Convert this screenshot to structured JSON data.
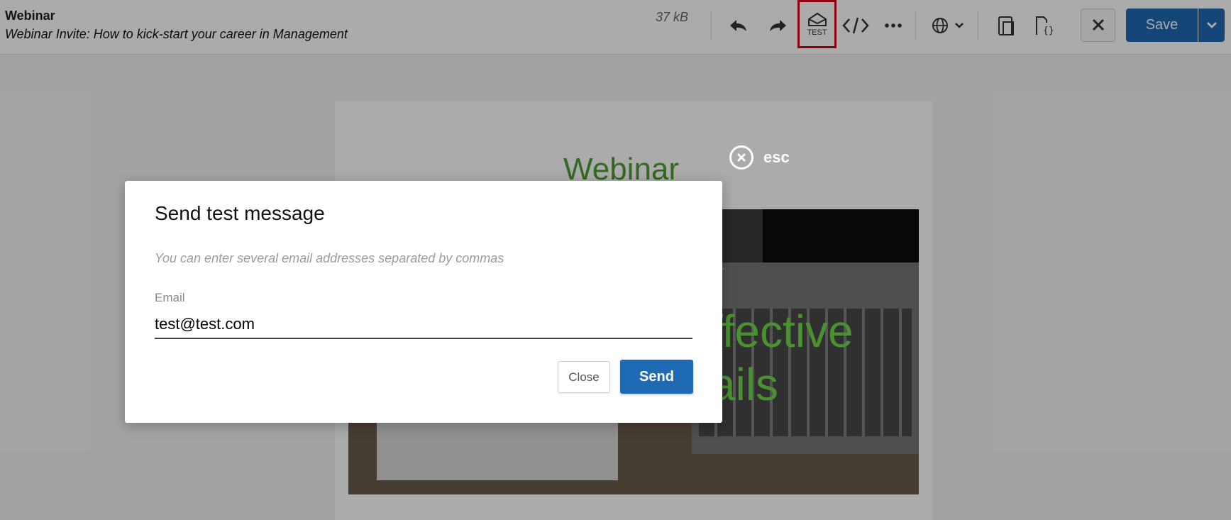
{
  "header": {
    "doc_title": "Webinar",
    "doc_subject": "Webinar Invite: How to kick-start your career in Management",
    "file_size": "37 kB"
  },
  "toolbar": {
    "undo_icon": "undo-icon",
    "redo_icon": "redo-icon",
    "test_label": "TEST",
    "code_icon": "code-icon",
    "more_icon": "more-icon",
    "language_icon": "globe-icon",
    "preview_icon": "device-preview-icon",
    "template_code_icon": "template-code-icon",
    "close_icon": "close-icon",
    "save_label": "Save"
  },
  "preview": {
    "logo_text": "Webinar",
    "hero_partial_small": "ar",
    "hero_partial_line1": "ffective",
    "hero_partial_line2": "ails"
  },
  "overlay": {
    "esc_label": "esc"
  },
  "modal": {
    "title": "Send test message",
    "hint": "You can enter several email addresses separated by commas",
    "email_label": "Email",
    "email_value": "test@test.com",
    "close_label": "Close",
    "send_label": "Send"
  },
  "colors": {
    "accent": "#1f6bb3",
    "highlight_border": "#d0021b",
    "logo_green": "#4f9c34"
  }
}
